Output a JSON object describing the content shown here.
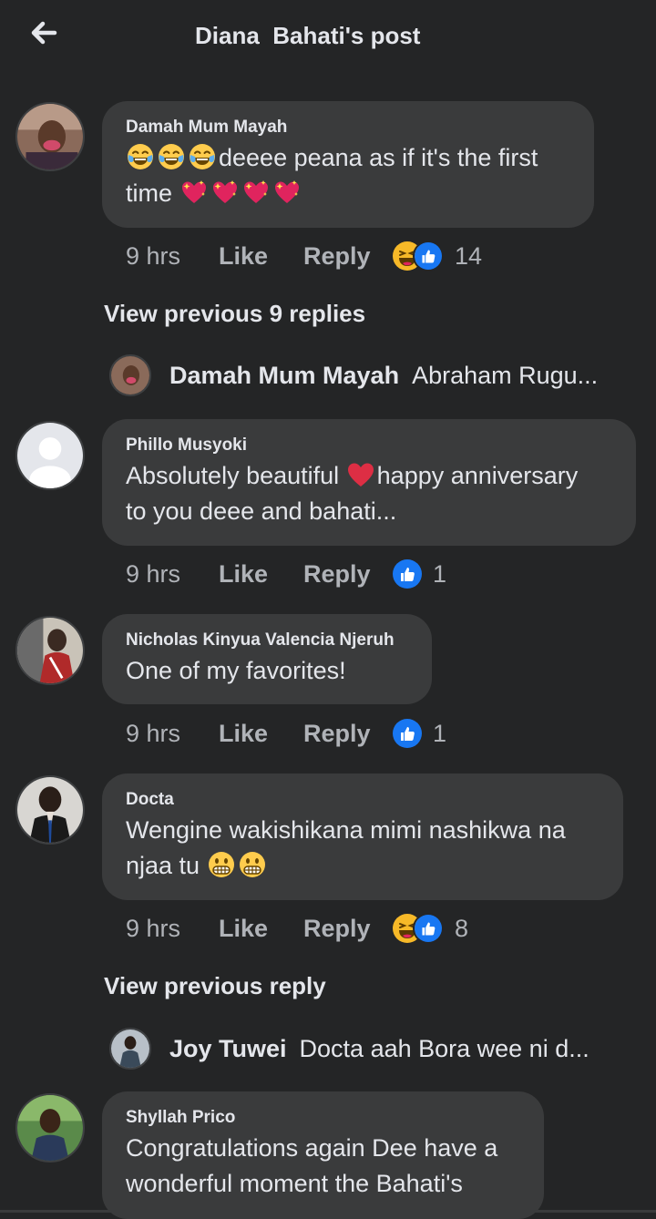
{
  "header": {
    "title": "Diana  Bahati's post"
  },
  "comments": [
    {
      "author": "Damah Mum Mayah",
      "text_after_emoji": "deeee peana as if it's the first",
      "text_line2": "time",
      "time": "9 hrs",
      "like_label": "Like",
      "reply_label": "Reply",
      "reaction_count": "14",
      "reactions": [
        "haha-reaction-icon",
        "like-reaction-icon"
      ]
    },
    {
      "author": "Phillo Musyoki",
      "text_part1": "Absolutely beautiful ",
      "text_part2": "happy anniversary",
      "text_line2": "to you deee and bahati...",
      "time": "9 hrs",
      "like_label": "Like",
      "reply_label": "Reply",
      "reaction_count": "1",
      "reactions": [
        "like-reaction-icon"
      ]
    },
    {
      "author": "Nicholas Kinyua Valencia Njeruh",
      "text": "One of my favorites!",
      "time": "9 hrs",
      "like_label": "Like",
      "reply_label": "Reply",
      "reaction_count": "1",
      "reactions": [
        "like-reaction-icon"
      ]
    },
    {
      "author": "Docta",
      "text_line1": "Wengine wakishikana mimi nashikwa na",
      "text_line2": "njaa tu",
      "time": "9 hrs",
      "like_label": "Like",
      "reply_label": "Reply",
      "reaction_count": "8",
      "reactions": [
        "haha-reaction-icon",
        "like-reaction-icon"
      ]
    },
    {
      "author": "Shyllah Prico",
      "text_line1": "Congratulations again Dee have a",
      "text_line2": "wonderful moment the Bahati's"
    }
  ],
  "view_previous_1": "View previous 9 replies",
  "view_previous_2": "View previous reply",
  "reply_previews": [
    {
      "name": "Damah Mum Mayah",
      "snippet": "Abraham Rugu..."
    },
    {
      "name": "Joy Tuwei",
      "snippet": "Docta aah Bora wee ni d..."
    }
  ],
  "colors": {
    "background": "#242526",
    "bubble": "#3a3b3c",
    "like_blue": "#1877f2",
    "haha_yellow": "#f7b928"
  }
}
